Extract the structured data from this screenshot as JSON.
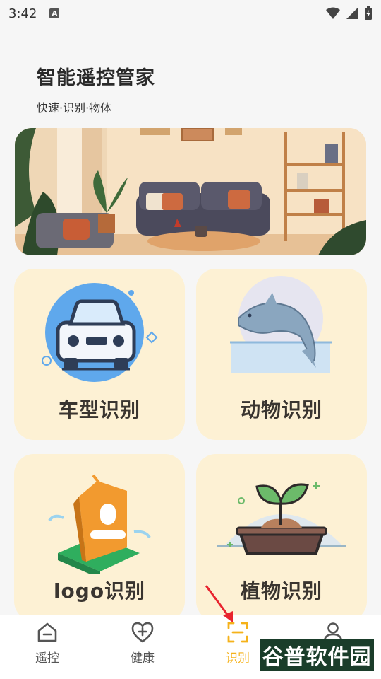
{
  "status_bar": {
    "time": "3:42",
    "notif_icon": "A"
  },
  "header": {
    "title": "智能遥控管家",
    "subtitle": "快速·识别·物体"
  },
  "banner": {
    "image": "living-room-illustration"
  },
  "cards": [
    {
      "id": "car",
      "label": "车型识别",
      "icon": "car-icon"
    },
    {
      "id": "animal",
      "label": "动物识别",
      "icon": "dolphin-icon"
    },
    {
      "id": "logo",
      "label": "logo识别",
      "icon": "logo-tag-icon"
    },
    {
      "id": "plant",
      "label": "植物识别",
      "icon": "plant-pot-icon"
    }
  ],
  "tabbar": {
    "tabs": [
      {
        "label": "遥控",
        "icon": "home-remote-icon",
        "active": false
      },
      {
        "label": "健康",
        "icon": "heart-plus-icon",
        "active": false
      },
      {
        "label": "识别",
        "icon": "scan-icon",
        "active": true
      },
      {
        "label": "",
        "icon": "person-icon",
        "active": false
      }
    ]
  },
  "watermark": {
    "text": "谷普软件园"
  },
  "colors": {
    "accent": "#f5b21a",
    "card_bg": "#fdf1d4",
    "page_bg": "#f6f6f6",
    "annotation": "#e8242f"
  }
}
